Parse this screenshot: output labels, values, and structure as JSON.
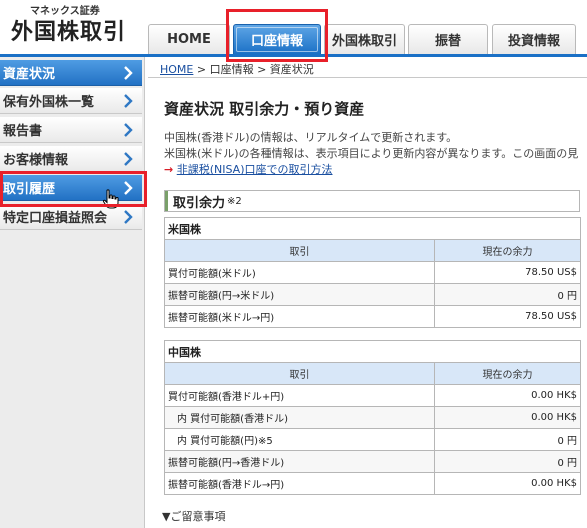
{
  "header": {
    "brand_small": "マネックス証券",
    "brand_title": "外国株取引",
    "tabs": [
      {
        "label": "HOME",
        "active": false
      },
      {
        "label": "口座情報",
        "active": true
      },
      {
        "label": "外国株取引",
        "active": false
      },
      {
        "label": "振替",
        "active": false
      },
      {
        "label": "投資情報",
        "active": false
      }
    ]
  },
  "sidebar": {
    "items": [
      {
        "label": "資産状況"
      },
      {
        "label": "保有外国株一覧"
      },
      {
        "label": "報告書"
      },
      {
        "label": "お客様情報"
      },
      {
        "label": "取引履歴"
      },
      {
        "label": "特定口座損益照会"
      }
    ]
  },
  "breadcrumb": {
    "home": "HOME",
    "sep": ">",
    "rest": "口座情報 > 資産状況"
  },
  "main": {
    "title": "資産状況 取引余力・預り資産",
    "note1": "中国株(香港ドル)の情報は、リアルタイムで更新されます。",
    "note2": "米国株(米ドル)の各種情報は、表示項目により更新内容が異なります。この画面の見",
    "nisa_arrow": "→",
    "nisa_link": "非課税(NISA)口座での取引方法",
    "section_title": "取引余力",
    "section_note": "※2",
    "footer": "▼ご留意事項"
  },
  "us_table": {
    "market": "米国株",
    "col_trade": "取引",
    "col_balance": "現在の余力",
    "rows": [
      {
        "label": "買付可能額(米ドル)",
        "value": "78.50 US$"
      },
      {
        "label": "振替可能額(円→米ドル)",
        "value": "0 円"
      },
      {
        "label": "振替可能額(米ドル→円)",
        "value": "78.50 US$"
      }
    ]
  },
  "cn_table": {
    "market": "中国株",
    "col_trade": "取引",
    "col_balance": "現在の余力",
    "rows": [
      {
        "label": "買付可能額(香港ドル+円)",
        "value": "0.00 HK$"
      },
      {
        "label": "内 買付可能額(香港ドル)",
        "value": "0.00 HK$"
      },
      {
        "label": "内 買付可能額(円)※5",
        "value": "0 円"
      },
      {
        "label": "振替可能額(円→香港ドル)",
        "value": "0 円"
      },
      {
        "label": "振替可能額(香港ドル→円)",
        "value": "0.00 HK$"
      }
    ]
  },
  "colors": {
    "accent_blue": "#1a70c6",
    "highlight_red": "#e8202a",
    "table_header": "#d8e7f8"
  }
}
